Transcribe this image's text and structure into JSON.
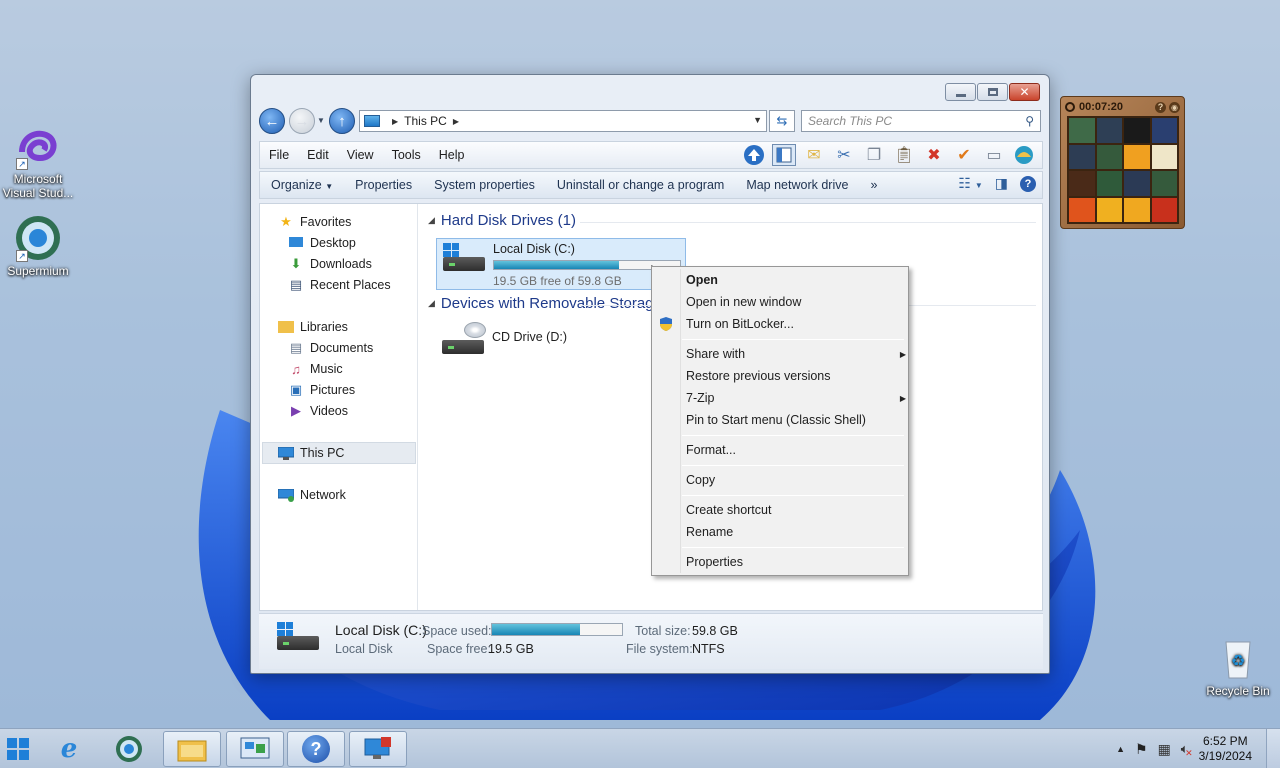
{
  "desktop": {
    "icons": [
      {
        "label_line1": "Microsoft",
        "label_line2": "Visual Stud..."
      },
      {
        "label_line1": "Supermium",
        "label_line2": ""
      },
      {
        "label_line1": "Recycle Bin",
        "label_line2": ""
      }
    ]
  },
  "window": {
    "address": {
      "location": "This PC"
    },
    "search_placeholder": "Search This PC",
    "menu": [
      "File",
      "Edit",
      "View",
      "Tools",
      "Help"
    ],
    "commands": {
      "organize": "Organize",
      "items": [
        "Properties",
        "System properties",
        "Uninstall or change a program",
        "Map network drive"
      ],
      "more": "»"
    },
    "nav": {
      "favorites": "Favorites",
      "favorites_items": [
        "Desktop",
        "Downloads",
        "Recent Places"
      ],
      "libraries": "Libraries",
      "libraries_items": [
        "Documents",
        "Music",
        "Pictures",
        "Videos"
      ],
      "this_pc": "This PC",
      "network": "Network"
    },
    "groups": {
      "hdd": "Hard Disk Drives (1)",
      "removable": "Devices with Removable Storage"
    },
    "drives": {
      "c": {
        "name": "Local Disk (C:)",
        "free_text": "19.5 GB free of 59.8 GB",
        "used_fraction": 0.674
      },
      "d": {
        "name": "CD Drive (D:)"
      }
    },
    "details": {
      "name": "Local Disk (C:)",
      "type": "Local Disk",
      "space_used_label": "Space used:",
      "space_free_label": "Space free:",
      "space_free": "19.5 GB",
      "total_size_label": "Total size:",
      "total_size": "59.8 GB",
      "file_system_label": "File system:",
      "file_system": "NTFS"
    }
  },
  "context_menu": {
    "items": [
      {
        "label": "Open",
        "bold": true
      },
      {
        "label": "Open in new window"
      },
      {
        "label": "Turn on BitLocker...",
        "icon": "shield-icon"
      },
      {
        "label": "Share with",
        "submenu": true
      },
      {
        "label": "Restore previous versions"
      },
      {
        "label": "7-Zip",
        "submenu": true
      },
      {
        "label": "Pin to Start menu (Classic Shell)"
      },
      {
        "label": "Format..."
      },
      {
        "label": "Copy"
      },
      {
        "label": "Create shortcut"
      },
      {
        "label": "Rename"
      },
      {
        "label": "Properties"
      }
    ]
  },
  "gadget": {
    "timer": "00:07:20"
  },
  "taskbar": {
    "time": "6:52 PM",
    "date": "3/19/2024"
  },
  "colors": {
    "accent": "#1e7fd8",
    "progress": "#1785b5",
    "link_blue": "#1e3a8a"
  }
}
